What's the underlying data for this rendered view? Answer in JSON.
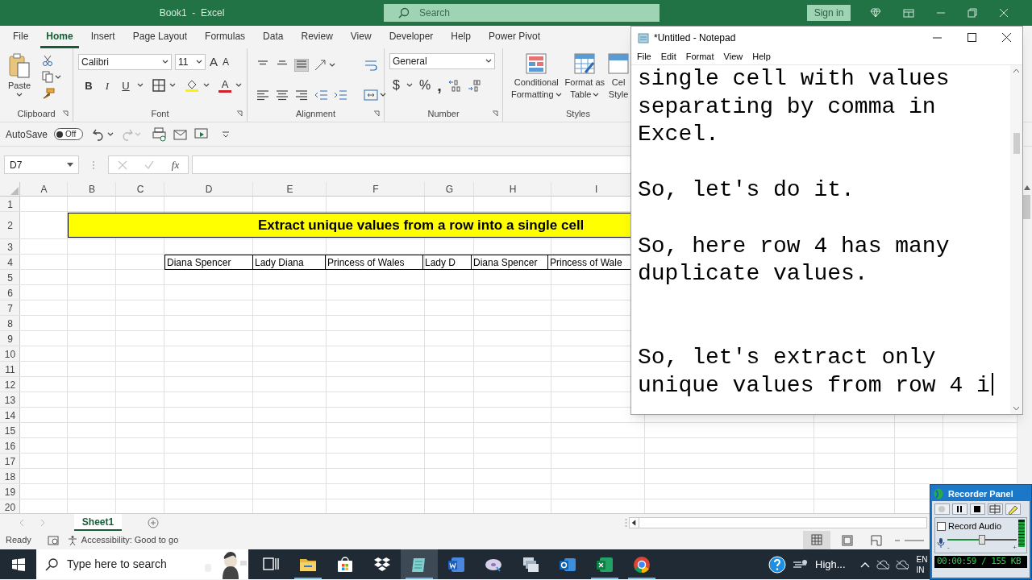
{
  "excel": {
    "title": "Book1  -  Excel",
    "search": {
      "placeholder": "Search"
    },
    "sign_in": "Sign in",
    "tabs": [
      {
        "label": "File",
        "selected": false
      },
      {
        "label": "Home",
        "selected": true
      },
      {
        "label": "Insert",
        "selected": false
      },
      {
        "label": "Page Layout",
        "selected": false
      },
      {
        "label": "Formulas",
        "selected": false
      },
      {
        "label": "Data",
        "selected": false
      },
      {
        "label": "Review",
        "selected": false
      },
      {
        "label": "View",
        "selected": false
      },
      {
        "label": "Developer",
        "selected": false
      },
      {
        "label": "Help",
        "selected": false
      },
      {
        "label": "Power Pivot",
        "selected": false
      }
    ],
    "ribbon": {
      "paste": "Paste",
      "font_name": "Calibri",
      "font_size": "11",
      "grow_font": "A",
      "shrink_font": "A",
      "style_buttons": [
        "B",
        "I",
        "U"
      ],
      "font_color": "A",
      "number_format": "General",
      "number_buttons": [
        "$",
        "%",
        ","
      ],
      "styles": [
        {
          "lines": [
            "Conditional",
            "Formatting"
          ],
          "dropdown": true
        },
        {
          "lines": [
            "Format as",
            "Table"
          ],
          "dropdown": true
        },
        {
          "lines": [
            "Cel",
            "Style"
          ],
          "dropdown": false
        }
      ],
      "groups": [
        "Clipboard",
        "Font",
        "Alignment",
        "Number",
        "Styles"
      ]
    },
    "autosave": {
      "label": "AutoSave",
      "state": "Off",
      "on": false
    },
    "name_box": "D7",
    "function_label": "fx",
    "columns": [
      "A",
      "B",
      "C",
      "D",
      "E",
      "F",
      "G",
      "H",
      "I"
    ],
    "rows": [
      "1",
      "2",
      "3",
      "4",
      "5",
      "6",
      "7",
      "8",
      "9",
      "10",
      "11",
      "12",
      "13",
      "14",
      "15",
      "16",
      "17",
      "18",
      "19",
      "20"
    ],
    "title_banner": "Extract unique values from a row into a single cell",
    "row4": [
      "Diana Spencer",
      "Lady Diana",
      "Princess of Wales",
      "Lady D",
      "Diana Spencer",
      "Princess of Wale"
    ],
    "sheet_tabs": [
      {
        "label": "Sheet1",
        "selected": true
      }
    ],
    "status": {
      "ready": "Ready",
      "accessibility": "Accessibility: Good to go"
    }
  },
  "notepad": {
    "title": "*Untitled - Notepad",
    "menu": [
      "File",
      "Edit",
      "Format",
      "View",
      "Help"
    ],
    "text": "single cell with values\nseparating by comma in\nExcel.\n\nSo, let's do it.\n\nSo, here row 4 has many\nduplicate values.\n\n\nSo, let's extract only\nunique values from row 4 i"
  },
  "recorder": {
    "title": "Recorder Panel",
    "record_audio": {
      "label": "Record Audio",
      "checked": false
    },
    "volume": {
      "level": 0.5,
      "min": "-",
      "max": "+"
    },
    "meter": {
      "level": 0.95
    },
    "status": "00:00:59 / 155 KB"
  },
  "taskbar": {
    "search": {
      "placeholder": "Type here to search"
    },
    "apps": [
      {
        "kind": "taskview",
        "running": false,
        "active": false
      },
      {
        "kind": "folder",
        "running": true,
        "active": false
      },
      {
        "kind": "store",
        "running": false,
        "active": false
      },
      {
        "kind": "box",
        "running": false,
        "active": false
      },
      {
        "kind": "notepad",
        "running": true,
        "active": true
      },
      {
        "kind": "word",
        "running": false,
        "active": false
      },
      {
        "kind": "disc",
        "running": false,
        "active": false
      },
      {
        "kind": "pages",
        "running": false,
        "active": false
      },
      {
        "kind": "mail",
        "running": false,
        "active": false
      },
      {
        "kind": "sheet",
        "running": true,
        "active": false
      },
      {
        "kind": "browser",
        "running": true,
        "active": false
      }
    ],
    "weather": "High...",
    "language": [
      "EN",
      "IN"
    ]
  }
}
